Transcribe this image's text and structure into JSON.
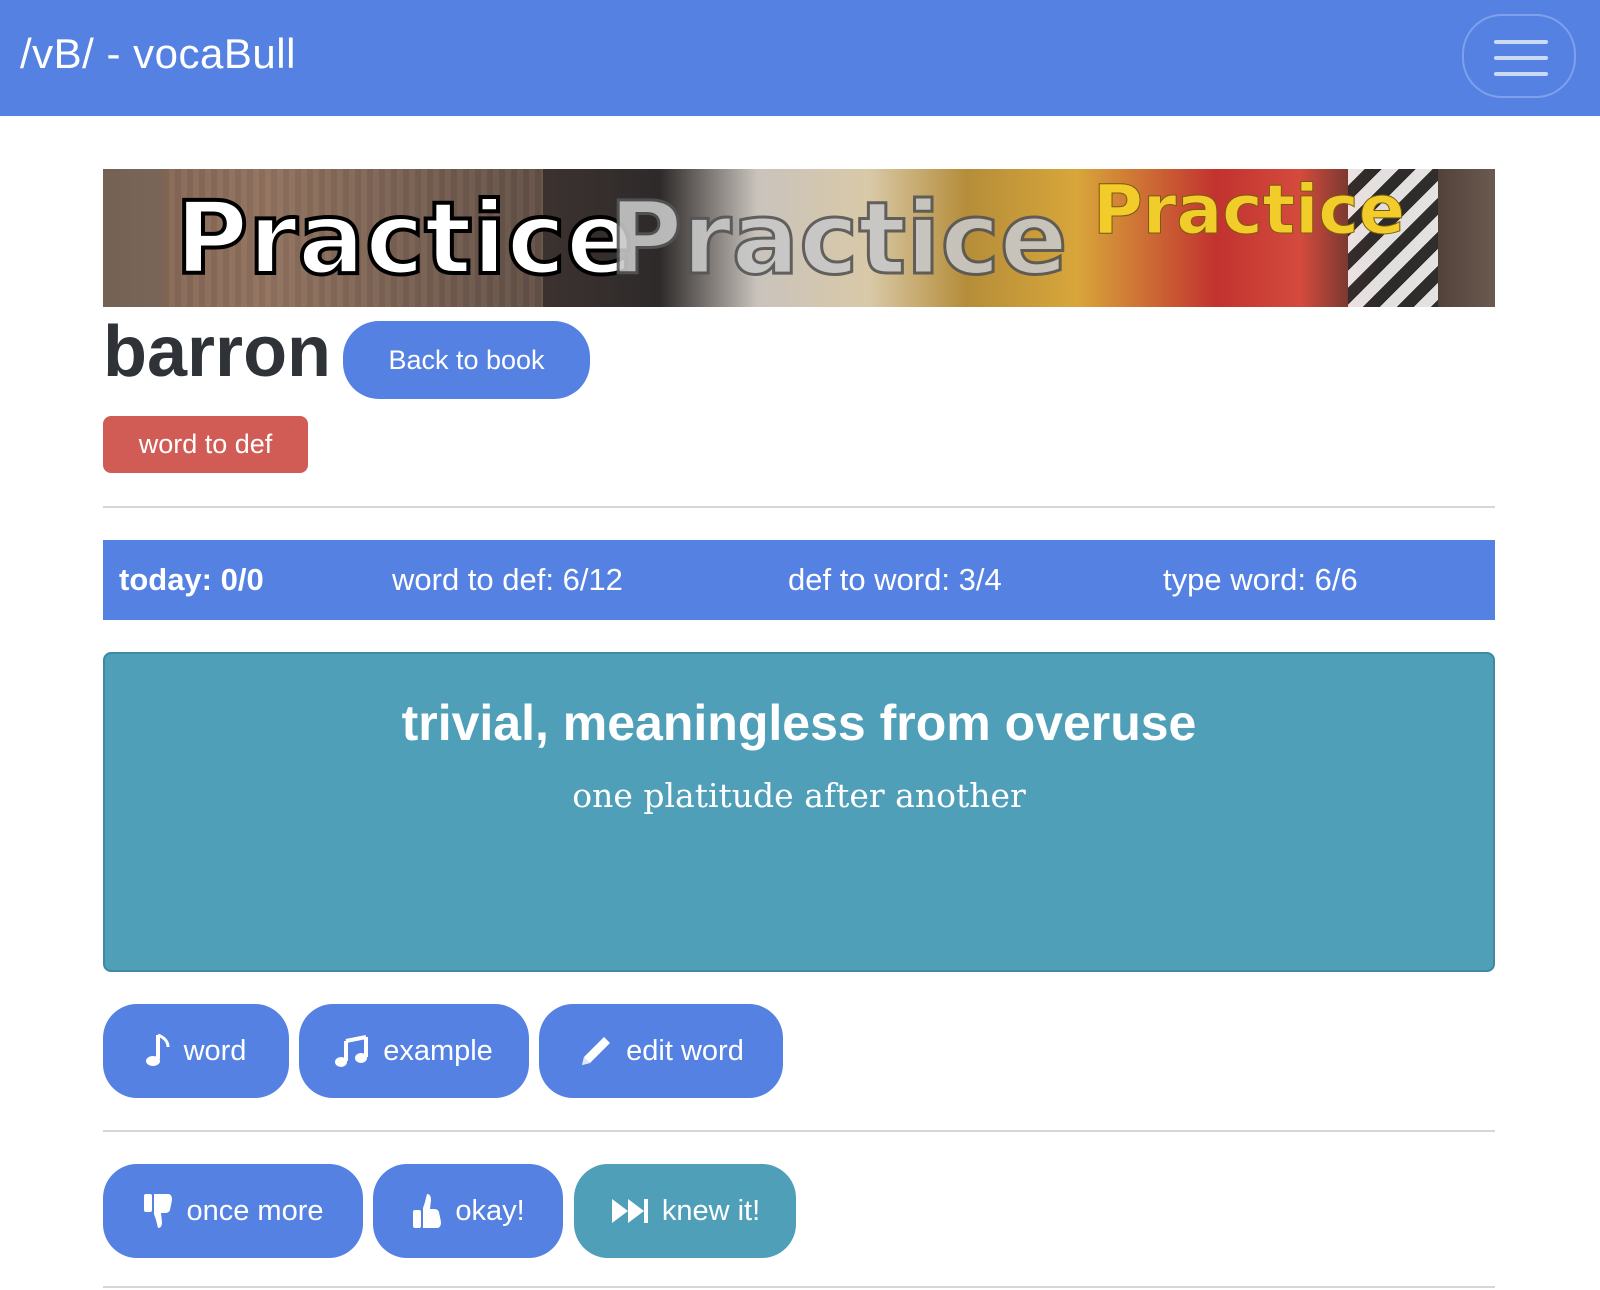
{
  "navbar": {
    "brand": "/vB/ - vocaBull",
    "menu_icon": "hamburger-icon"
  },
  "banner": {
    "words": [
      "Practice",
      "Practice",
      "Practice"
    ]
  },
  "word": {
    "title": "barron",
    "back_label": "Back to book",
    "mode_badge": "word to def"
  },
  "stats": {
    "today": "today: 0/0",
    "word_to_def": "word to def: 6/12",
    "def_to_word": "def to word: 3/4",
    "type_word": "type word: 6/6"
  },
  "card": {
    "definition": "trivial, meaningless from overuse",
    "example": "one platitude after another"
  },
  "actions": {
    "word_label": "word",
    "word_icon": "music-note-icon",
    "example_label": "example",
    "example_icon": "music-notes-icon",
    "edit_label": "edit word",
    "edit_icon": "pencil-icon"
  },
  "ratings": {
    "once_more_label": "once more",
    "once_more_icon": "thumbs-down-icon",
    "okay_label": "okay!",
    "okay_icon": "thumbs-up-icon",
    "knew_label": "knew it!",
    "knew_icon": "skip-forward-icon"
  },
  "colors": {
    "primary": "#5581e3",
    "info": "#4f9fb8",
    "danger": "#d15c55"
  }
}
